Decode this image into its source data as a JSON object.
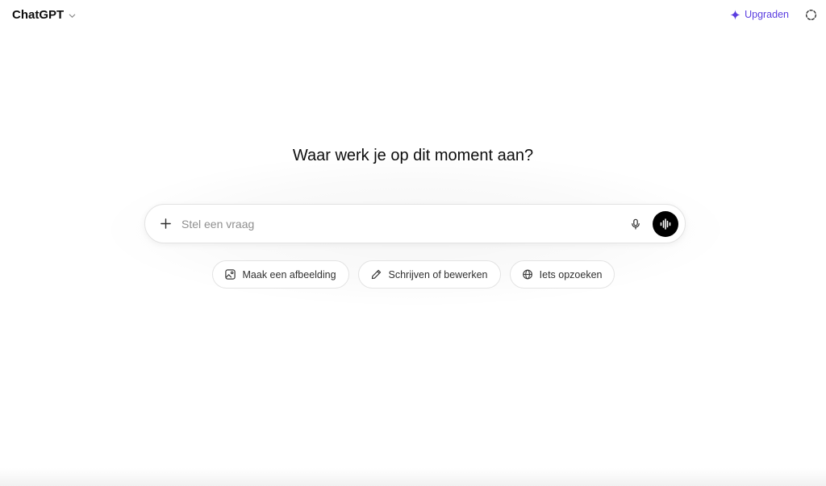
{
  "header": {
    "model_name": "ChatGPT",
    "upgrade_label": "Upgraden",
    "accent_color": "#5b3ee0"
  },
  "main": {
    "headline": "Waar werk je op dit moment aan?",
    "composer": {
      "placeholder": "Stel een vraag",
      "value": ""
    },
    "chips": [
      {
        "label": "Maak een afbeelding",
        "icon": "image-icon"
      },
      {
        "label": "Schrijven of bewerken",
        "icon": "pencil-icon"
      },
      {
        "label": "Iets opzoeken",
        "icon": "globe-icon"
      }
    ]
  }
}
